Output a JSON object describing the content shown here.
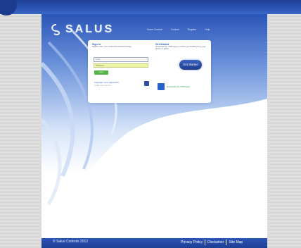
{
  "header": {
    "logo_text": "SALUS",
    "nav": [
      "Home Comfort",
      "Contact",
      "Register",
      "Help"
    ]
  },
  "login_panel": {
    "left_heading": "Sign In",
    "left_intro": "Please enter your email and password below",
    "email_placeholder": "email",
    "password_placeholder": "Password",
    "go_button": "Log In",
    "forgot_link": "Forgotten your password?",
    "left_sub": "Create a new account",
    "right_heading": "Get Started",
    "right_text": "Download the iT500 app to control your heating from your phone or tablet",
    "pill_label": "Get Started",
    "app_link": "Download the iT500 app"
  },
  "footer": {
    "copyright": "© Salus Controls 2012",
    "links": [
      "Privacy Policy",
      "Disclaimer",
      "Site Map"
    ]
  },
  "colors": {
    "banner": "#2c57b6",
    "accent_green": "#58b14a",
    "link_blue": "#2a5db0"
  }
}
